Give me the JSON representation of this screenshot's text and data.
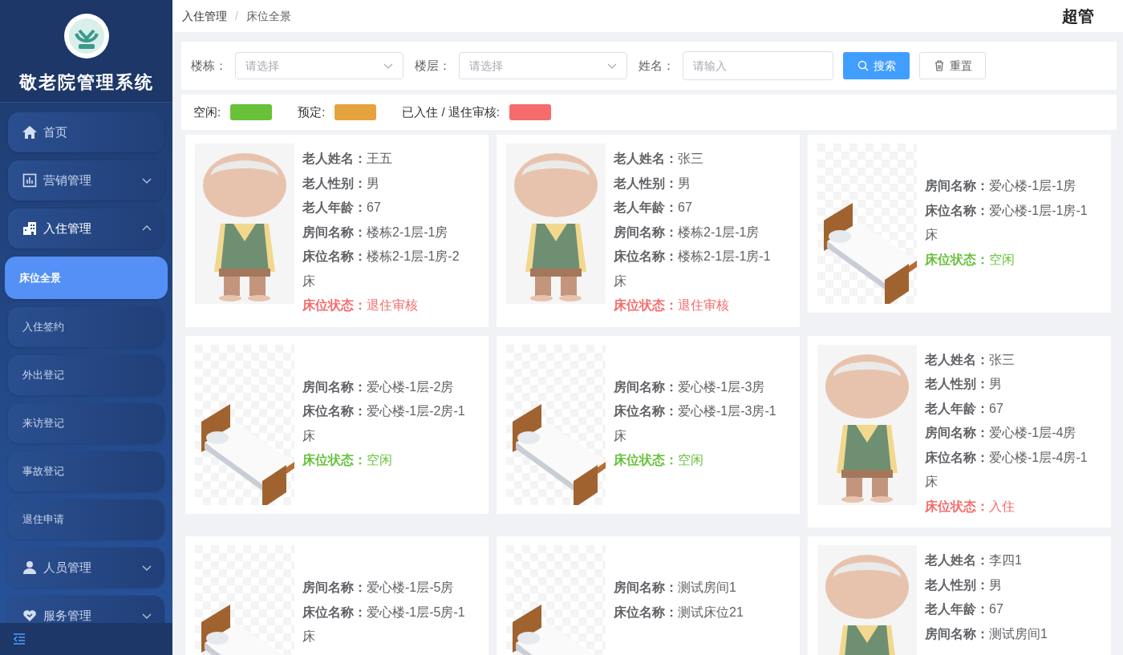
{
  "sidebar": {
    "title": "敬老院管理系统",
    "items": [
      {
        "label": "首页",
        "selected": false
      },
      {
        "label": "营销管理",
        "expanded": false,
        "selected": false
      },
      {
        "label": "入住管理",
        "expanded": true,
        "selected": false,
        "children": [
          {
            "label": "床位全景",
            "selected": true
          },
          {
            "label": "入住签约",
            "selected": false
          },
          {
            "label": "外出登记",
            "selected": false
          },
          {
            "label": "来访登记",
            "selected": false
          },
          {
            "label": "事故登记",
            "selected": false
          },
          {
            "label": "退住申请",
            "selected": false
          }
        ]
      },
      {
        "label": "人员管理",
        "expanded": false,
        "selected": false
      },
      {
        "label": "服务管理",
        "expanded": false,
        "selected": false
      }
    ]
  },
  "breadcrumb": [
    "入住管理",
    "床位全景"
  ],
  "breadcrumb_separator": "/",
  "user": "超管",
  "filters": [
    {
      "label": "楼栋：",
      "kind": "select",
      "placeholder": "请选择"
    },
    {
      "label": "楼层：",
      "kind": "select",
      "placeholder": "请选择"
    },
    {
      "label": "姓名：",
      "kind": "input",
      "placeholder": "请输入"
    }
  ],
  "buttons": [
    {
      "label": "搜索",
      "kind": "primary"
    },
    {
      "label": "重置",
      "kind": "reset"
    }
  ],
  "legend": [
    {
      "label": "空闲:",
      "color": "#67c23a"
    },
    {
      "label": "预定:",
      "color": "#e6a23c"
    },
    {
      "label": "已入住 / 退住审核:",
      "color": "#f56c6c"
    }
  ],
  "cards": [
    {
      "kind": "elder",
      "fields": [
        {
          "label": "老人姓名：",
          "value": "王五"
        },
        {
          "label": "老人性别：",
          "value": "男"
        },
        {
          "label": "老人年龄：",
          "value": "67"
        },
        {
          "label": "房间名称：",
          "value": "楼栋2-1层-1房"
        },
        {
          "label": "床位名称：",
          "value": "楼栋2-1层-1房-2床"
        }
      ],
      "status": {
        "label": "床位状态：",
        "value": "退住审核",
        "color": "#f56c6c"
      }
    },
    {
      "kind": "elder",
      "fields": [
        {
          "label": "老人姓名：",
          "value": "张三"
        },
        {
          "label": "老人性别：",
          "value": "男"
        },
        {
          "label": "老人年龄：",
          "value": "67"
        },
        {
          "label": "房间名称：",
          "value": "楼栋2-1层-1房"
        },
        {
          "label": "床位名称：",
          "value": "楼栋2-1层-1房-1床"
        }
      ],
      "status": {
        "label": "床位状态：",
        "value": "退住审核",
        "color": "#f56c6c"
      }
    },
    {
      "kind": "bed",
      "fields": [
        {
          "label": "房间名称：",
          "value": "爱心楼-1层-1房"
        },
        {
          "label": "床位名称：",
          "value": "爱心楼-1层-1房-1床"
        }
      ],
      "status": {
        "label": "床位状态：",
        "value": "空闲",
        "color": "#67c23a"
      }
    },
    {
      "kind": "bed",
      "fields": [
        {
          "label": "房间名称：",
          "value": "爱心楼-1层-2房"
        },
        {
          "label": "床位名称：",
          "value": "爱心楼-1层-2房-1床"
        }
      ],
      "status": {
        "label": "床位状态：",
        "value": "空闲",
        "color": "#67c23a"
      }
    },
    {
      "kind": "bed",
      "fields": [
        {
          "label": "房间名称：",
          "value": "爱心楼-1层-3房"
        },
        {
          "label": "床位名称：",
          "value": "爱心楼-1层-3房-1床"
        }
      ],
      "status": {
        "label": "床位状态：",
        "value": "空闲",
        "color": "#67c23a"
      }
    },
    {
      "kind": "elder",
      "fields": [
        {
          "label": "老人姓名：",
          "value": "张三"
        },
        {
          "label": "老人性别：",
          "value": "男"
        },
        {
          "label": "老人年龄：",
          "value": "67"
        },
        {
          "label": "房间名称：",
          "value": "爱心楼-1层-4房"
        },
        {
          "label": "床位名称：",
          "value": "爱心楼-1层-4房-1床"
        }
      ],
      "status": {
        "label": "床位状态：",
        "value": "入住",
        "color": "#f56c6c"
      }
    },
    {
      "kind": "bed",
      "fields": [
        {
          "label": "房间名称：",
          "value": "爱心楼-1层-5房"
        },
        {
          "label": "床位名称：",
          "value": "爱心楼-1层-5房-1床"
        }
      ]
    },
    {
      "kind": "bed",
      "fields": [
        {
          "label": "房间名称：",
          "value": "测试房间1"
        },
        {
          "label": "床位名称：",
          "value": "测试床位21"
        }
      ]
    },
    {
      "kind": "elder",
      "fields": [
        {
          "label": "老人姓名：",
          "value": "李四1"
        },
        {
          "label": "老人性别：",
          "value": "男"
        },
        {
          "label": "老人年龄：",
          "value": "67"
        },
        {
          "label": "房间名称：",
          "value": "测试房间1"
        }
      ]
    }
  ]
}
